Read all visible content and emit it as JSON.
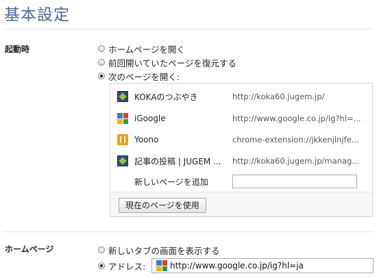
{
  "title": "基本設定",
  "startup": {
    "label": "起動時",
    "options": [
      {
        "label": "ホームページを開く",
        "checked": false
      },
      {
        "label": "前回開いていたページを復元する",
        "checked": false
      },
      {
        "label": "次のページを開く:",
        "checked": true
      }
    ],
    "pages": [
      {
        "name": "KOKAのつぶやき",
        "url": "http://koka60.jugem.jp/",
        "icon": "koka-favicon-icon"
      },
      {
        "name": "iGoogle",
        "url": "http://www.google.co.jp/ig?hl=...",
        "icon": "google-favicon-icon"
      },
      {
        "name": "Yoono",
        "url": "chrome-extension://jkkenjlnjfe...",
        "icon": "yoono-favicon-icon"
      },
      {
        "name": "記事の投稿 | JUGEM ...",
        "url": "http://koka60.jugem.jp/manag...",
        "icon": "koka-favicon-icon"
      }
    ],
    "add_page_label": "新しいページを追加",
    "add_page_value": "",
    "use_current_button": "現在のページを使用"
  },
  "homepage": {
    "label": "ホームページ",
    "options": [
      {
        "label": "新しいタブの画面を表示する",
        "checked": false
      },
      {
        "label": "アドレス:",
        "checked": true
      }
    ],
    "address_value": "http://www.google.co.jp/ig?hl=ja"
  },
  "colors": {
    "title": "#4a6a9a",
    "google": [
      "#3a7bd5",
      "#e0412c",
      "#f4b400",
      "#1f9e48"
    ]
  }
}
